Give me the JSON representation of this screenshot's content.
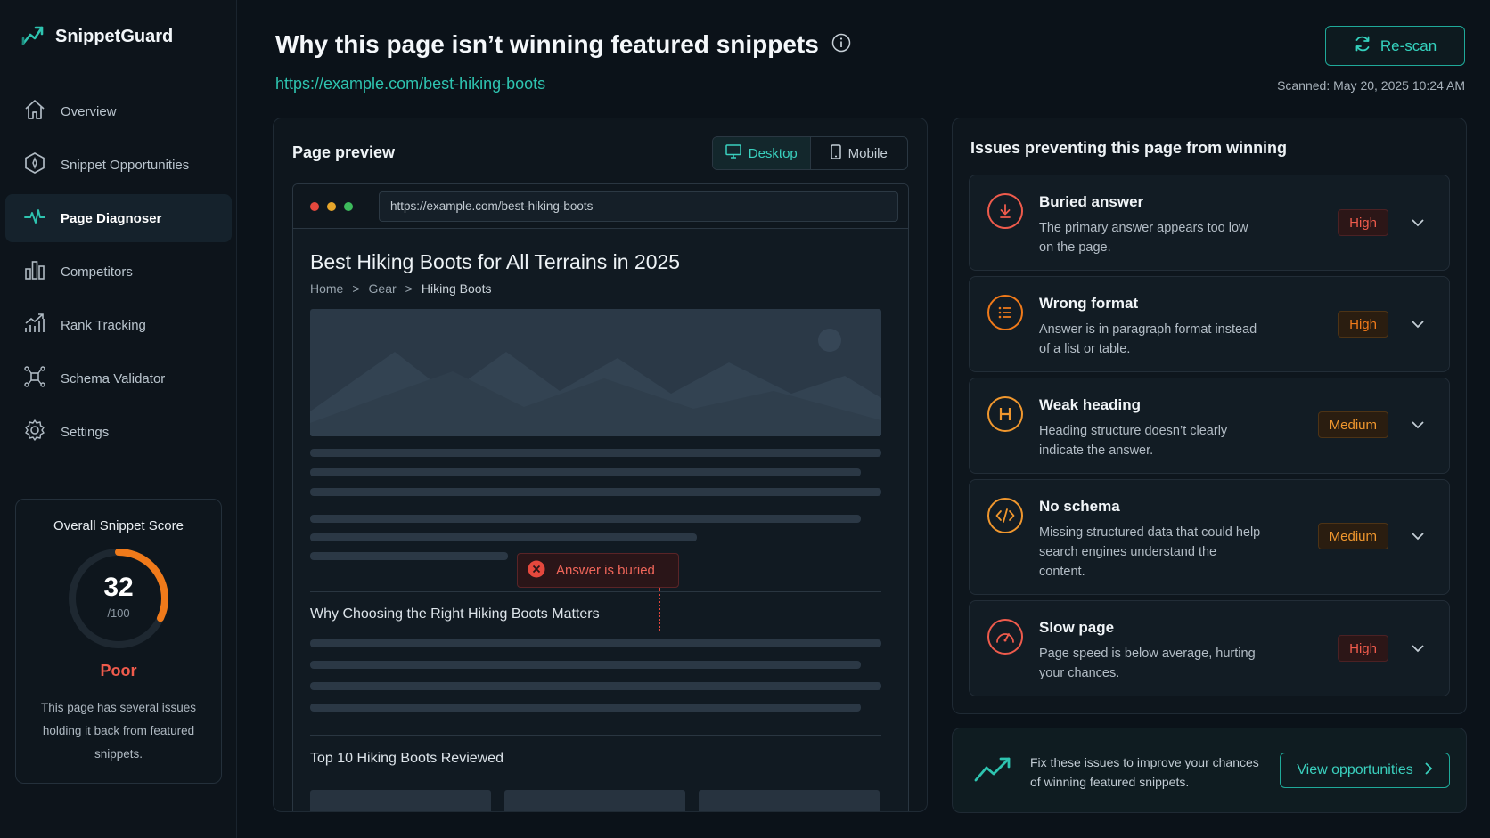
{
  "app": {
    "name": "SnippetGuard"
  },
  "sidebar": {
    "items": [
      {
        "label": "Overview",
        "icon": "home-icon"
      },
      {
        "label": "Snippet Opportunities",
        "icon": "target-icon"
      },
      {
        "label": "Page Diagnoser",
        "icon": "pulse-icon",
        "active": true
      },
      {
        "label": "Competitors",
        "icon": "bar-chart-icon"
      },
      {
        "label": "Rank Tracking",
        "icon": "trend-chart-icon"
      },
      {
        "label": "Schema Validator",
        "icon": "schema-icon"
      },
      {
        "label": "Settings",
        "icon": "gear-icon"
      }
    ]
  },
  "score": {
    "title": "Overall Snippet Score",
    "value": "32",
    "max": "/100",
    "fraction": 0.32,
    "label": "Poor",
    "description": "This page has several issues holding it back from featured snippets."
  },
  "header": {
    "title": "Why this page isn’t winning featured snippets",
    "url": "https://example.com/best-hiking-boots",
    "rescan_label": "Re-scan",
    "scanned": "Scanned: May 20, 2025 10:24 AM"
  },
  "preview": {
    "title": "Page preview",
    "toggle": {
      "desktop": "Desktop",
      "mobile": "Mobile",
      "selected": "Desktop"
    },
    "browser_url": "https://example.com/best-hiking-boots",
    "article_title": "Best Hiking Boots for All Terrains in 2025",
    "breadcrumb": [
      "Home",
      "Gear",
      "Hiking Boots"
    ],
    "breadcrumb_sep": ">",
    "callout": "Answer is buried",
    "section1": "Why Choosing the Right Hiking Boots Matters",
    "section2": "Top 10 Hiking Boots Reviewed"
  },
  "issues": {
    "title": "Issues preventing this page from winning",
    "items": [
      {
        "name": "Buried answer",
        "description": "The primary answer appears too low on the page.",
        "severity": "High",
        "icon": "arrow-down-circle-icon"
      },
      {
        "name": "Wrong format",
        "description": "Answer is in paragraph format instead of a list or table.",
        "severity": "High",
        "icon": "list-icon"
      },
      {
        "name": "Weak heading",
        "description": "Heading structure doesn’t clearly indicate the answer.",
        "severity": "Medium",
        "icon": "heading-icon"
      },
      {
        "name": "No schema",
        "description": "Missing structured data that could help search engines understand the content.",
        "severity": "Medium",
        "icon": "code-icon"
      },
      {
        "name": "Slow page",
        "description": "Page speed is below average, hurting your chances.",
        "severity": "High",
        "icon": "speedometer-icon"
      }
    ]
  },
  "cta": {
    "text": "Fix these issues to improve your chances of winning featured snippets.",
    "button": "View opportunities",
    "icon": "trend-up-icon"
  },
  "colors": {
    "accent": "#2ec4b0",
    "high": "#ef5b4c",
    "medium": "#f0972e",
    "background": "#0b1219"
  }
}
